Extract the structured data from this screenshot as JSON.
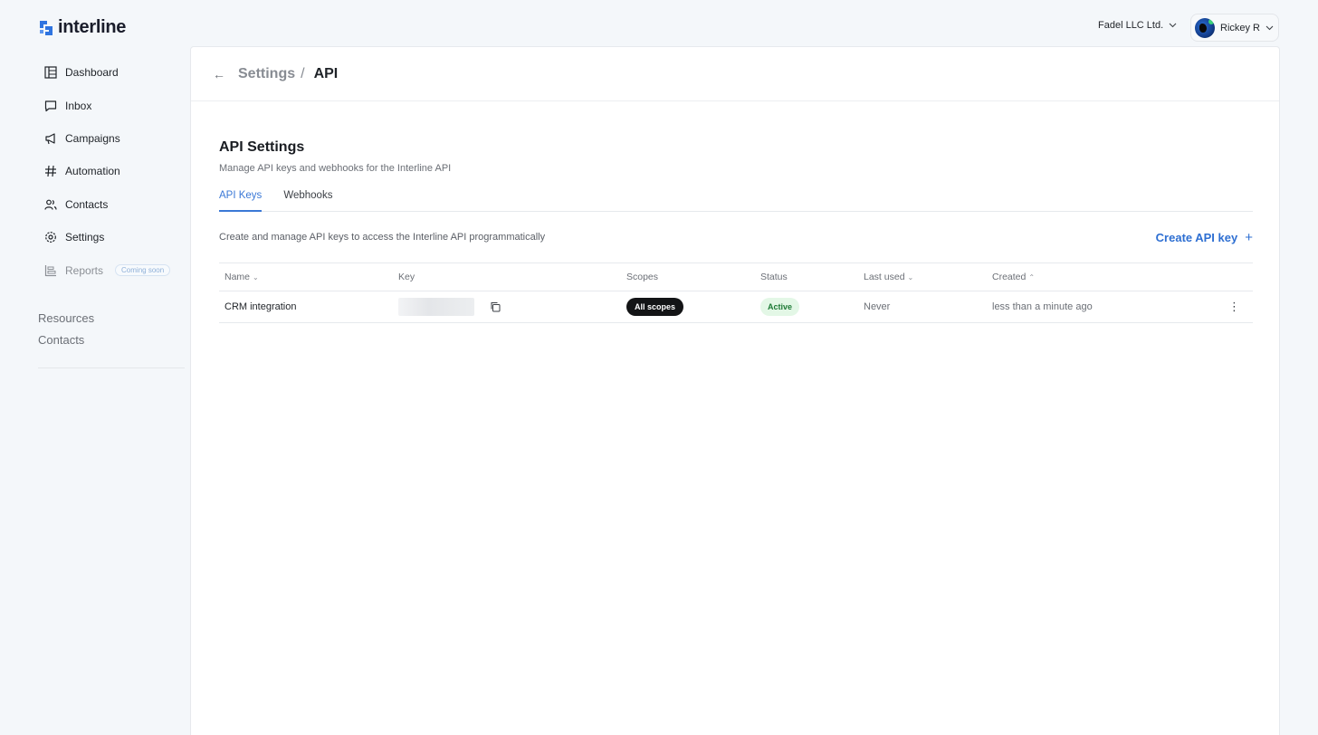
{
  "brand": {
    "name": "interline",
    "accent": "#2f74e0"
  },
  "sidebar": {
    "items": [
      {
        "label": "Dashboard",
        "icon": "dashboard-icon"
      },
      {
        "label": "Inbox",
        "icon": "chat-icon"
      },
      {
        "label": "Campaigns",
        "icon": "megaphone-icon"
      },
      {
        "label": "Automation",
        "icon": "hash-icon"
      },
      {
        "label": "Contacts",
        "icon": "users-icon"
      },
      {
        "label": "Settings",
        "icon": "gear-icon"
      },
      {
        "label": "Reports",
        "icon": "reports-icon",
        "badge": "Coming soon"
      }
    ],
    "links": [
      "Resources",
      "Contacts"
    ]
  },
  "topbar": {
    "org": "Fadel LLC Ltd.",
    "user": "Rickey R"
  },
  "breadcrumb": {
    "parent": "Settings",
    "separator": "/",
    "current": "API"
  },
  "page": {
    "title": "API Settings",
    "subtitle": "Manage API keys and webhooks for the Interline API",
    "tabs": [
      {
        "label": "API Keys",
        "active": true
      },
      {
        "label": "Webhooks",
        "active": false
      }
    ],
    "description": "Create and manage API keys to access the Interline API programmatically",
    "create_label": "Create API key",
    "create_plus": "+"
  },
  "table": {
    "columns": [
      "Name",
      "Key",
      "Scopes",
      "Status",
      "Last used",
      "Created"
    ],
    "rows": [
      {
        "name": "CRM integration",
        "scopes": "All scopes",
        "status": "Active",
        "last_used": "Never",
        "created": "less than a minute ago"
      }
    ]
  },
  "colors": {
    "active_tab": "#3a78d6",
    "status_active_bg": "#e3f7e6",
    "status_active_fg": "#1e7a36"
  }
}
